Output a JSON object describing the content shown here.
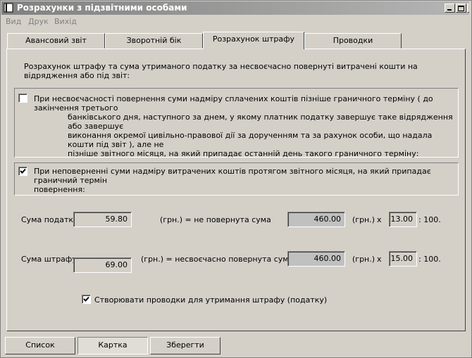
{
  "window": {
    "title": "Розрахунки з підзвітними особами"
  },
  "menu": [
    "Вид",
    "Друк",
    "Вихід"
  ],
  "tabs": [
    "Авансовий звіт",
    "Зворотній бік",
    "Розрахунок штрафу",
    "Проводки"
  ],
  "heading": "Розрахунок штрафу та сума утриманого податку за несвоєчасно повернуті витрачені кошти на відрядження або під звіт:",
  "option1": {
    "checked": false,
    "lines": [
      "При несвоєчасності повернення суми надміру сплачених коштів пізніше граничного терміну ( до закінчення третього",
      "банківського дня, наступного за днем, у якому платник податку завершує таке відрядження або завершує",
      "виконання окремої цивільно-правової дії за дорученням та за рахунок особи, що надала кошти під звіт ), але не",
      "пізніше звітного місяця, на який припадає останній день такого граничного терміну:"
    ]
  },
  "option2": {
    "checked": true,
    "lines": [
      "При неповерненні суми надміру витрачених коштів протягом звітного місяця, на який припадає граничний термін",
      "повернення:"
    ]
  },
  "tax_row": {
    "label": "Сума податку:",
    "value": "59.80",
    "middle": "(грн.)  =  не повернута сума",
    "amount": "460.00",
    "unit": "(грн.)",
    "times": "x",
    "rate": "13.00",
    "divider": ": 100."
  },
  "fine_row": {
    "label": "Сума штрафу:",
    "value": "69.00",
    "middle": "(грн.)  =  несвоєчасно повернута сума",
    "amount": "460.00",
    "unit": "(грн.)",
    "times": "x",
    "rate": "15.00",
    "divider": ": 100."
  },
  "create_entries": {
    "checked": true,
    "label": "Створювати проводки для утримання штрафу (податку)"
  },
  "buttons": [
    "Список",
    "Картка",
    "Зберегти"
  ]
}
